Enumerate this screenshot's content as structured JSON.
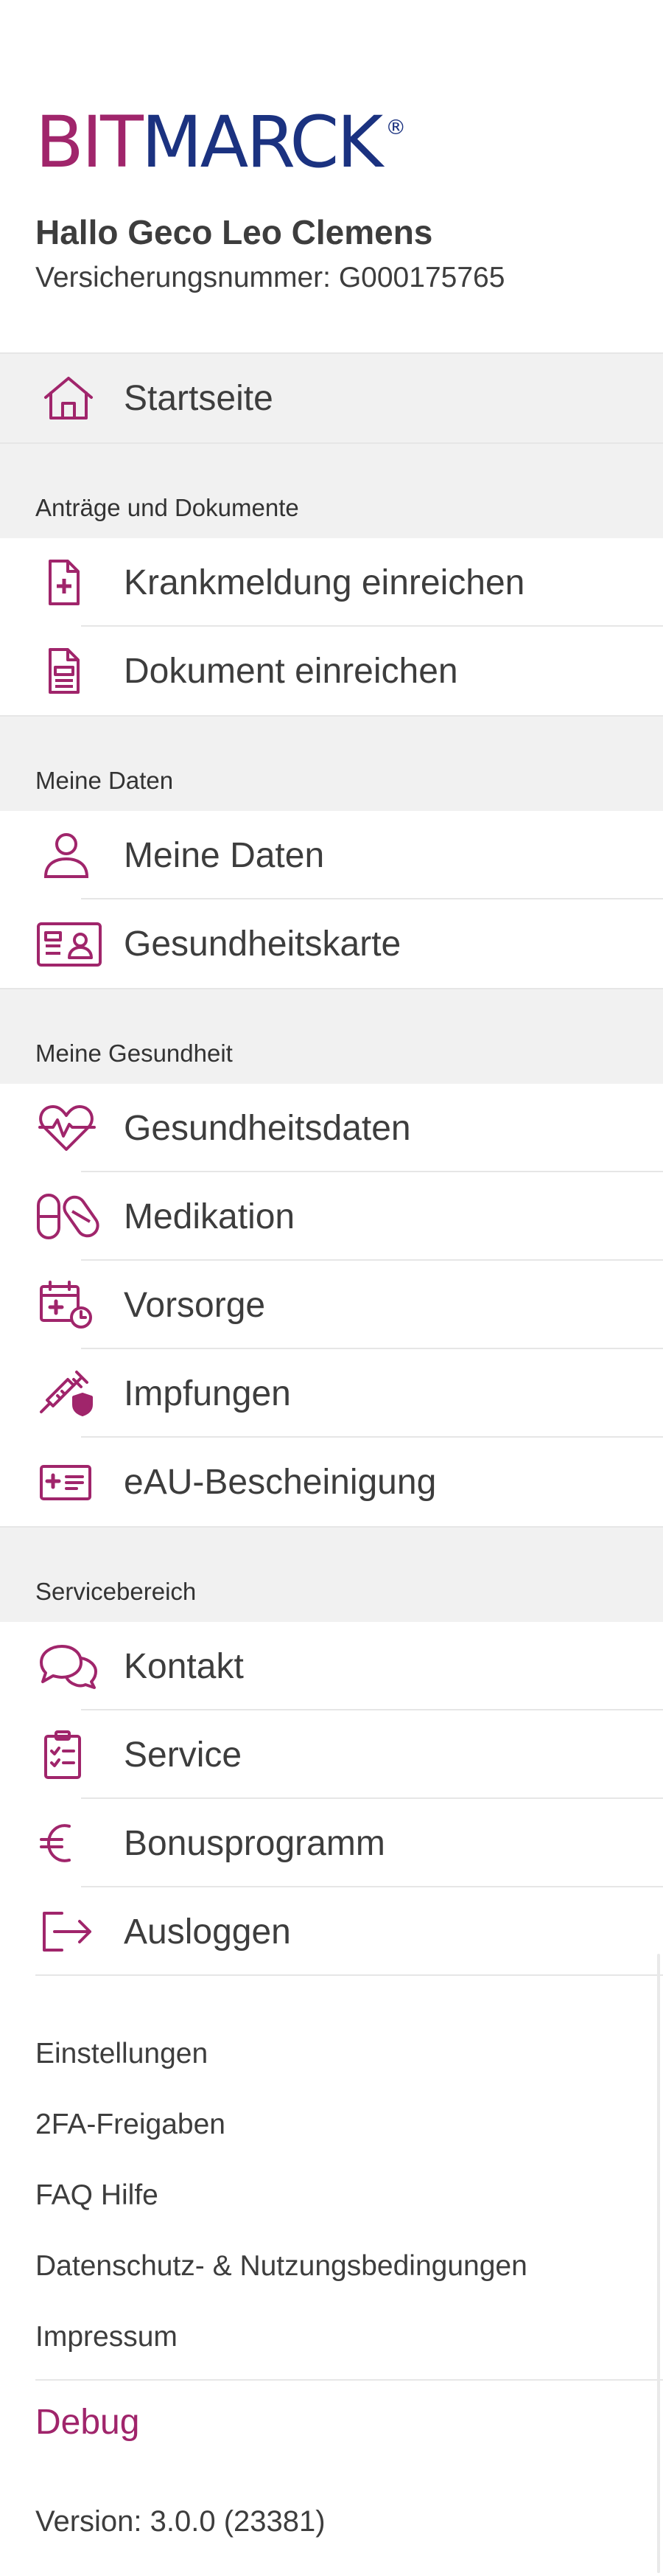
{
  "brand": {
    "logo_part1": "BIT",
    "logo_part2": "MARCK",
    "logo_mark": "®"
  },
  "user": {
    "greeting": "Hallo Geco Leo Clemens",
    "insurance_number": "Versicherungsnummer: G000175765"
  },
  "menu": {
    "home": {
      "label": "Startseite",
      "icon": "home-icon"
    },
    "sections": [
      {
        "title": "Anträge und Dokumente",
        "items": [
          {
            "label": "Krankmeldung einreichen",
            "icon": "medical-document-icon"
          },
          {
            "label": "Dokument einreichen",
            "icon": "document-icon"
          }
        ]
      },
      {
        "title": "Meine Daten",
        "items": [
          {
            "label": "Meine Daten",
            "icon": "person-icon"
          },
          {
            "label": "Gesundheitskarte",
            "icon": "id-card-icon"
          }
        ]
      },
      {
        "title": "Meine Gesundheit",
        "items": [
          {
            "label": "Gesundheitsdaten",
            "icon": "heart-pulse-icon"
          },
          {
            "label": "Medikation",
            "icon": "pills-icon"
          },
          {
            "label": "Vorsorge",
            "icon": "calendar-clock-icon"
          },
          {
            "label": "Impfungen",
            "icon": "syringe-icon"
          },
          {
            "label": "eAU-Bescheinigung",
            "icon": "certificate-icon"
          }
        ]
      },
      {
        "title": "Servicebereich",
        "items": [
          {
            "label": "Kontakt",
            "icon": "chat-icon"
          },
          {
            "label": "Service",
            "icon": "clipboard-icon"
          },
          {
            "label": "Bonusprogramm",
            "icon": "euro-icon"
          },
          {
            "label": "Ausloggen",
            "icon": "logout-icon"
          }
        ]
      }
    ]
  },
  "links": [
    "Einstellungen",
    "2FA-Freigaben",
    "FAQ Hilfe",
    "Datenschutz- & Nutzungsbedingungen",
    "Impressum"
  ],
  "debug_label": "Debug",
  "version": "Version: 3.0.0 (23381)",
  "colors": {
    "accent": "#a0256b",
    "brand_blue": "#1b3280",
    "section_bg": "#f1f1f1",
    "text": "#3d3d3d"
  }
}
